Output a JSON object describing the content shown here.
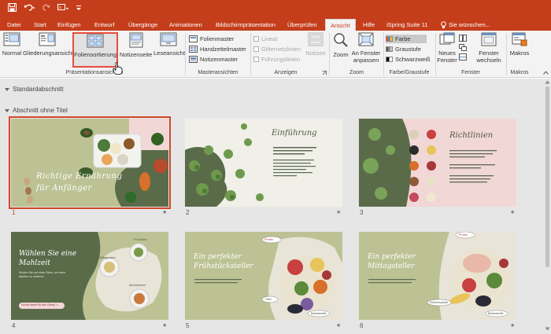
{
  "titlebar": {
    "save_icon": "save-icon",
    "undo_icon": "undo-icon",
    "redo_icon": "redo-icon",
    "start_icon": "start-from-beginning-icon",
    "customize_icon": "customize-qat-icon"
  },
  "tabs": [
    {
      "label": "Datei"
    },
    {
      "label": "Start"
    },
    {
      "label": "Einfügen"
    },
    {
      "label": "Entwurf"
    },
    {
      "label": "Übergänge"
    },
    {
      "label": "Animationen"
    },
    {
      "label": "Bildschirmpräsentation"
    },
    {
      "label": "Überprüfen"
    },
    {
      "label": "Ansicht"
    },
    {
      "label": "Hilfe"
    },
    {
      "label": "iSpring Suite 11"
    }
  ],
  "tell_me": "Sie wünschen...",
  "ribbon": {
    "praesentationsansichten": {
      "label": "Präsentationsansichten",
      "normal": "Normal",
      "gliederung": "Gliederungsansicht",
      "foliensortierung": "Foliensortierung",
      "notizenseite": "Notizenseite",
      "leseansicht": "Leseansicht"
    },
    "masteransichten": {
      "label": "Masteransichten",
      "folienmaster": "Folienmaster",
      "handzettelmaster": "Handzettelmaster",
      "notizenmaster": "Notizenmaster"
    },
    "anzeigen": {
      "label": "Anzeigen",
      "lineal": "Lineal",
      "gitternetzlinien": "Gitternetzlinien",
      "fuehrungslinien": "Führungslinien",
      "notizen": "Notizen"
    },
    "zoom": {
      "label": "Zoom",
      "zoom": "Zoom",
      "an_fenster_1": "An Fenster",
      "an_fenster_2": "anpassen"
    },
    "farbe": {
      "label": "Farbe/Graustufe",
      "farbe": "Farbe",
      "graustufe": "Graustufe",
      "schwarzweiss": "Schwarzweiß"
    },
    "fenster": {
      "label": "Fenster",
      "neues_1": "Neues",
      "neues_2": "Fenster",
      "wechseln_1": "Fenster",
      "wechseln_2": "wechseln"
    },
    "makros": {
      "label": "Makros",
      "makros": "Makros"
    }
  },
  "sections": [
    {
      "title": "Standardabschnitt"
    },
    {
      "title": "Abschnitt ohne Titel"
    }
  ],
  "slides": [
    {
      "number": "1",
      "title": "Richtige Ernährung für Anfänger"
    },
    {
      "number": "2",
      "title": "Einführung"
    },
    {
      "number": "3",
      "title": "Richtlinien"
    },
    {
      "number": "4",
      "title": "Wählen Sie eine Mahlzeit",
      "sub": "Klicken Sie auf einen Teller, um mehr darüber zu erfahren.",
      "cta": "Ich bin bereit für den Check ->",
      "labels": [
        "Frühstück",
        "Mittagessen",
        "Abendessen"
      ]
    },
    {
      "number": "5",
      "title": "Ein perfekter Frühstücksteller",
      "tags": [
        "Protein",
        "Obst",
        "Gemüse",
        "Ballaststoffe"
      ]
    },
    {
      "number": "6",
      "title": "Ein perfekter Mittagsteller",
      "tags": [
        "Protein",
        "Gemüse",
        "Kohlenhydrate",
        "Ballaststoffe"
      ]
    }
  ],
  "colors": {
    "accent": "#c43e1c",
    "selection": "#d24726",
    "slide_bg": "#bcc294",
    "slide_dark": "#5a6b4a",
    "slide_pink": "#f2d7d7"
  }
}
